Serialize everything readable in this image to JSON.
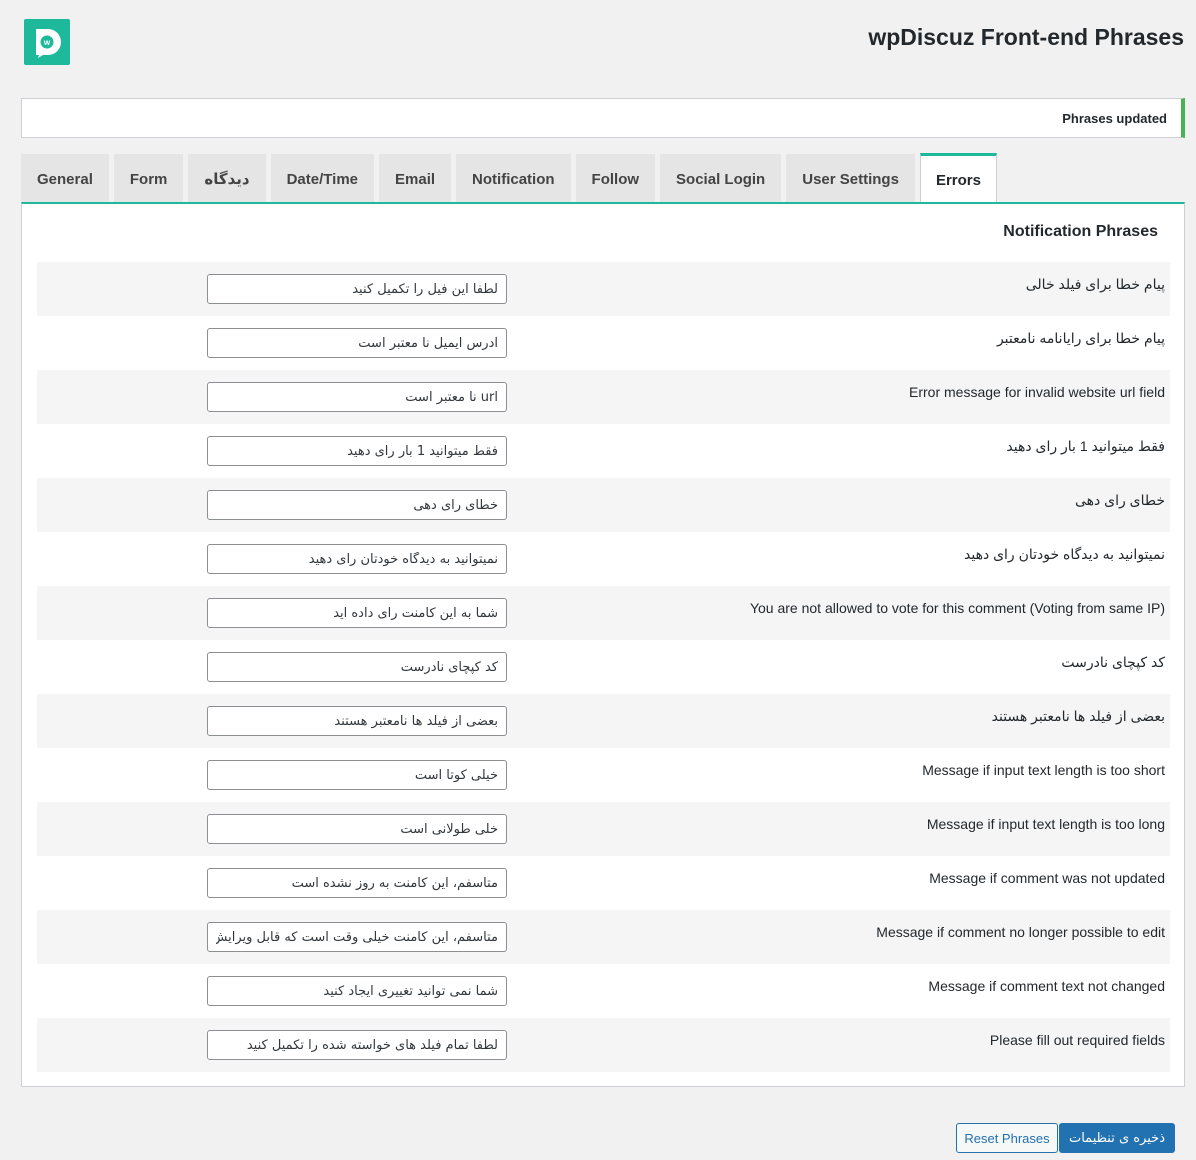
{
  "header": {
    "title": "wpDiscuz Front-end Phrases",
    "logo_icon": "wpdiscuz-logo-icon",
    "logo_color": "#1db99a"
  },
  "notice": {
    "text": "Phrases updated"
  },
  "tabs": [
    {
      "label": "General"
    },
    {
      "label": "Form"
    },
    {
      "label": "دیدگاه"
    },
    {
      "label": "Date/Time"
    },
    {
      "label": "Email"
    },
    {
      "label": "Notification"
    },
    {
      "label": "Follow"
    },
    {
      "label": "Social Login"
    },
    {
      "label": "User Settings"
    },
    {
      "label": "Errors",
      "active": true
    }
  ],
  "panel": {
    "title": "Notification Phrases",
    "rows": [
      {
        "label": "پیام خطا برای فیلد خالی",
        "value": "لطفا این فیل را تکمیل کنید"
      },
      {
        "label": "پیام خطا برای رایانامه نامعتبر",
        "value": "آدرس ایمیل نا معتبر است"
      },
      {
        "label": "Error message for invalid website url field",
        "value": "url نا معتبر است"
      },
      {
        "label": "فقط میتوانید 1 بار رای دهید",
        "value": "فقط میتوانید 1 بار رای دهید"
      },
      {
        "label": "خطای رای دهی",
        "value": "خطای رای دهی"
      },
      {
        "label": "نمیتوانید به دیدگاه خودتان رای دهید",
        "value": "نمیتوانید به دیدگاه خودتان رای دهید"
      },
      {
        "label": "You are not allowed to vote for this comment (Voting from same IP)",
        "value": "شما به این کامنت رای داده اید"
      },
      {
        "label": "کد کپچای نادرست",
        "value": "کد کپچای نادرست"
      },
      {
        "label": "بعضی از فیلد ها نامعتبر هستند",
        "value": "بعضی از فیلد ها نامعتبر هستند"
      },
      {
        "label": "Message if input text length is too short",
        "value": "خیلی کوتا است"
      },
      {
        "label": "Message if input text length is too long",
        "value": "خلی طولانی است"
      },
      {
        "label": "Message if comment was not updated",
        "value": "متاسفم، این کامنت به روز نشده است"
      },
      {
        "label": "Message if comment no longer possible to edit",
        "value": "متاسفم، این کامنت خیلی وقت است که قابل ویرایش نیست"
      },
      {
        "label": "Message if comment text not changed",
        "value": "شما نمی توانید تغییری ایجاد کنید"
      },
      {
        "label": "Please fill out required fields",
        "value": "لطفا تمام فیلد های خواسته شده را تکمیل کنید"
      }
    ]
  },
  "buttons": {
    "reset_label": "Reset Phrases",
    "save_label": "ذخیره ی تنظیمات"
  }
}
